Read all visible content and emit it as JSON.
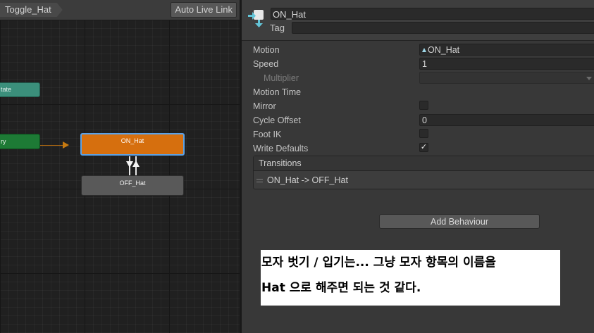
{
  "graph": {
    "breadcrumb": "Toggle_Hat",
    "auto_live_link_label": "Auto Live Link",
    "nodes": {
      "any_state": "tate",
      "entry": "ry",
      "on": "ON_Hat",
      "off": "OFF_Hat"
    }
  },
  "inspector": {
    "state_name": "ON_Hat",
    "tag_label": "Tag",
    "tag_value": "",
    "fields": {
      "motion_label": "Motion",
      "motion_value": "ON_Hat",
      "speed_label": "Speed",
      "speed_value": "1",
      "multiplier_label": "Multiplier",
      "motion_time_label": "Motion Time",
      "mirror_label": "Mirror",
      "cycle_offset_label": "Cycle Offset",
      "cycle_offset_value": "0",
      "foot_ik_label": "Foot IK",
      "write_defaults_label": "Write Defaults"
    },
    "checkbox_states": {
      "mirror": false,
      "foot_ik": false,
      "write_defaults": true
    },
    "transitions_header": "Transitions",
    "transitions": [
      "ON_Hat -> OFF_Hat"
    ],
    "add_behaviour_label": "Add Behaviour"
  },
  "caption": {
    "line1": "모자 벗기 / 입기는... 그냥 모자 항목의 이름을",
    "line2": "Hat 으로 해주면 되는 것 같다."
  },
  "colors": {
    "on_state": "#d66f0e",
    "off_state": "#595959",
    "entry_node": "#1d7a35",
    "any_state_node": "#3b8f7b",
    "selection_outline": "#5aa2e8"
  }
}
